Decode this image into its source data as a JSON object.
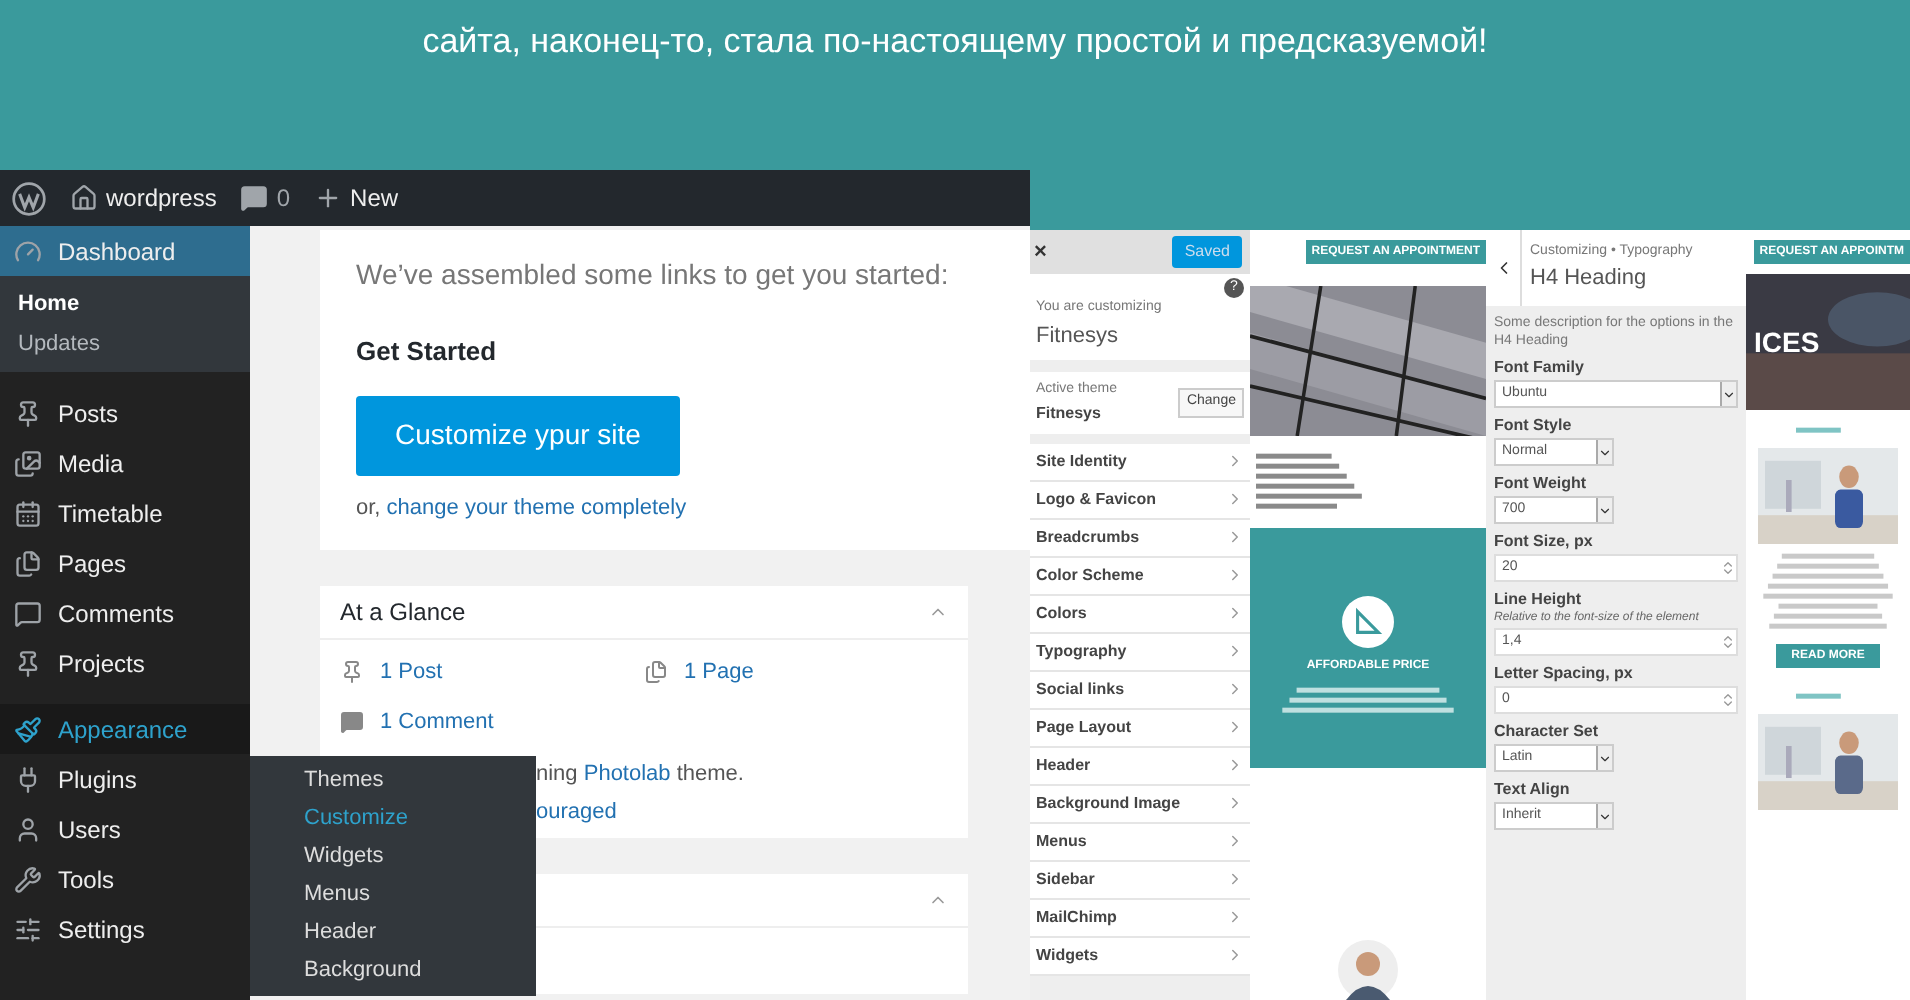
{
  "banner": {
    "text": "сайта, наконец-то, стала по-настоящему простой и предсказуемой!"
  },
  "admin_bar": {
    "site": "wordpress",
    "comments": "0",
    "new": "New"
  },
  "sidebar": {
    "items": [
      {
        "label": "Dashboard",
        "selected": true,
        "hovered": false,
        "children": [
          {
            "label": "Home",
            "selected": true
          },
          {
            "label": "Updates",
            "selected": false
          }
        ]
      },
      {
        "label": "Posts",
        "selected": false,
        "hovered": false
      },
      {
        "label": "Media",
        "selected": false,
        "hovered": false
      },
      {
        "label": "Timetable",
        "selected": false,
        "hovered": false
      },
      {
        "label": "Pages",
        "selected": false,
        "hovered": false
      },
      {
        "label": "Comments",
        "selected": false,
        "hovered": false
      },
      {
        "label": "Projects",
        "selected": false,
        "hovered": false
      },
      {
        "label": "Appearance",
        "selected": false,
        "hovered": true
      },
      {
        "label": "Plugins",
        "selected": false,
        "hovered": false
      },
      {
        "label": "Users",
        "selected": false,
        "hovered": false
      },
      {
        "label": "Tools",
        "selected": false,
        "hovered": false
      },
      {
        "label": "Settings",
        "selected": false,
        "hovered": false
      }
    ]
  },
  "flyout": {
    "items": [
      {
        "label": "Themes",
        "selected": false
      },
      {
        "label": "Customize",
        "selected": true
      },
      {
        "label": "Widgets",
        "selected": false
      },
      {
        "label": "Menus",
        "selected": false
      },
      {
        "label": "Header",
        "selected": false
      },
      {
        "label": "Background",
        "selected": false
      }
    ]
  },
  "welcome": {
    "intro": "We’ve assembled some links to get you started:",
    "heading": "Get Started",
    "button": "Customize ypur site",
    "or": "or, ",
    "link": "change your theme completely"
  },
  "glance": {
    "title": "At a Glance",
    "posts": "1 Post",
    "pages": "1 Page",
    "comments": "1 Comment",
    "theme_before": "ning ",
    "theme_link": "Photolab",
    "theme_after": " theme.",
    "line2": "ouraged"
  },
  "customizer": {
    "saved": "Saved",
    "close": "×",
    "help": "?",
    "customizing": "You are customizing",
    "site": "Fitnesys",
    "active_label": "Active theme",
    "active_theme": "Fitnesys",
    "change": "Change",
    "sections": [
      "Site Identity",
      "Logo & Favicon",
      "Breadcrumbs",
      "Color Scheme",
      "Colors",
      "Typography",
      "Social links",
      "Page Layout",
      "Header",
      "Background Image",
      "Menus",
      "Sidebar",
      "MailChimp",
      "Widgets"
    ]
  },
  "preview_1": {
    "button": "REQUEST AN APPOINTMENT",
    "feature": "AFFORDABLE PRICE"
  },
  "typography": {
    "breadcrumb": "Customizing • Typography",
    "title": "H4 Heading",
    "description": "Some description for the options in the H4 Heading",
    "fields": [
      {
        "kind": "select",
        "label": "Font Family",
        "value": "Ubuntu",
        "wide": true
      },
      {
        "kind": "select",
        "label": "Font Style",
        "value": "Normal",
        "wide": false
      },
      {
        "kind": "select",
        "label": "Font Weight",
        "value": "700",
        "wide": false
      },
      {
        "kind": "number",
        "label": "Font Size, px",
        "value": "20"
      },
      {
        "kind": "number",
        "label": "Line Height",
        "hint": "Relative to the font-size of the element",
        "value": "1,4"
      },
      {
        "kind": "number",
        "label": "Letter Spacing, px",
        "value": "0"
      },
      {
        "kind": "select",
        "label": "Character Set",
        "value": "Latin",
        "wide": false
      },
      {
        "kind": "select",
        "label": "Text Align",
        "value": "Inherit",
        "wide": false
      }
    ]
  },
  "preview_2": {
    "button": "REQUEST AN APPOINTM",
    "hero": "ICES",
    "read_more": "READ MORE"
  }
}
